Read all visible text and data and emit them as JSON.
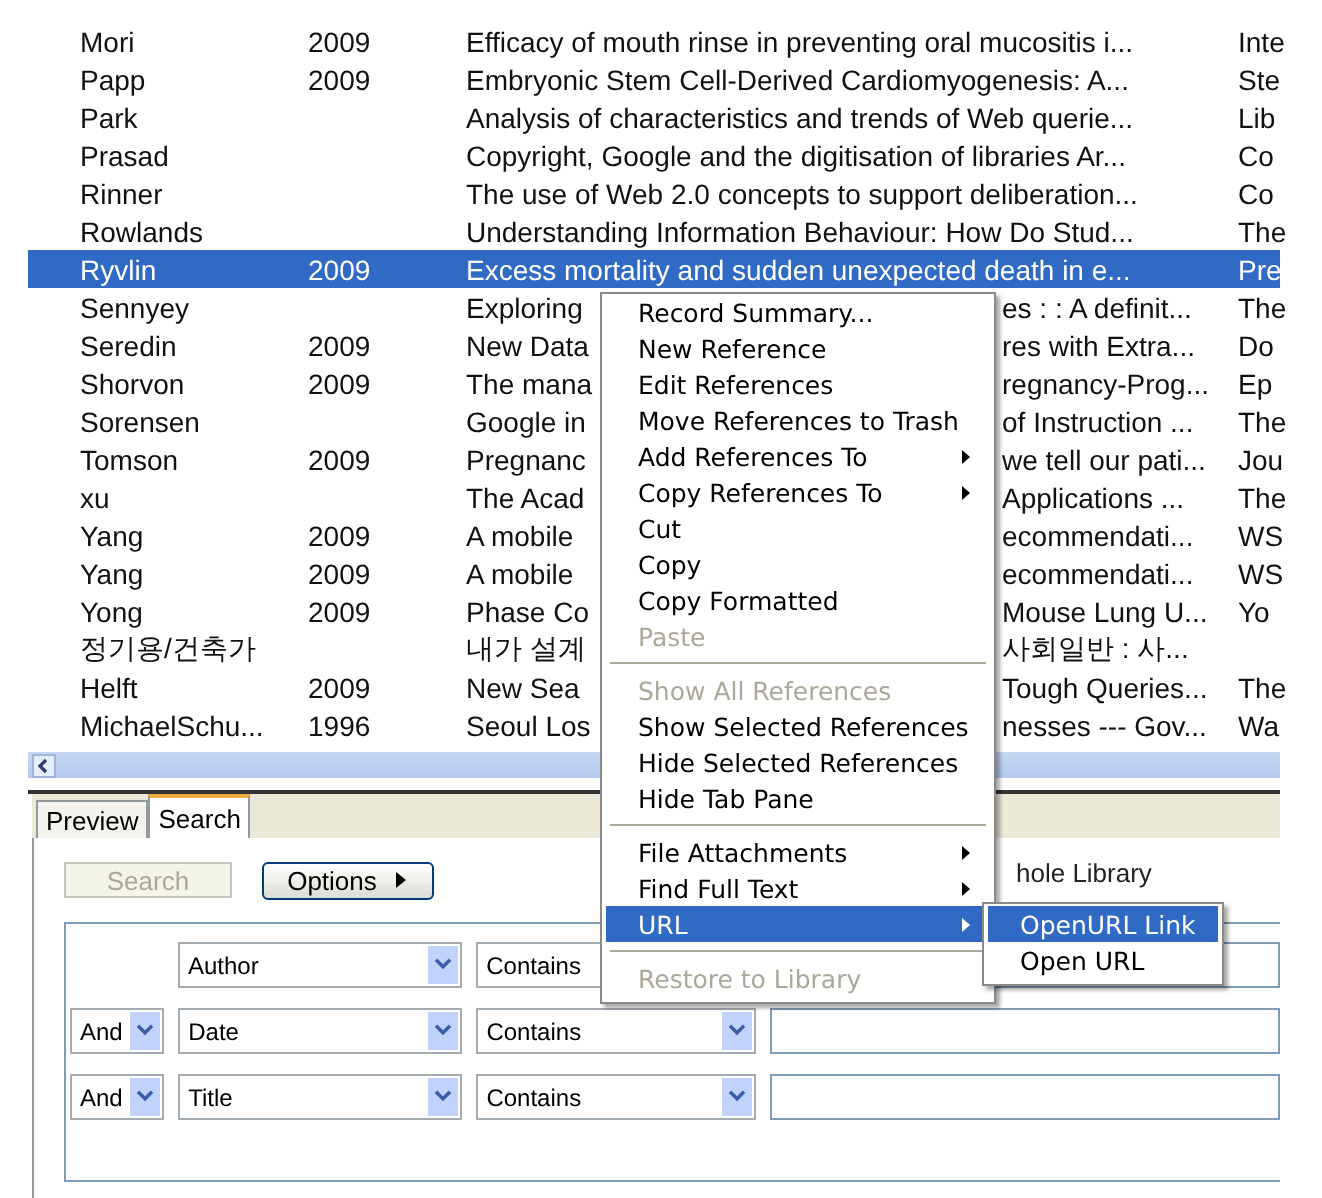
{
  "references": {
    "rows": [
      {
        "author": "Mori",
        "year": "2009",
        "title": "Efficacy of mouth rinse in preventing oral mucositis i...",
        "journal": "Inte",
        "selected": false
      },
      {
        "author": "Papp",
        "year": "2009",
        "title": "Embryonic Stem Cell-Derived Cardiomyogenesis: A...",
        "journal": "Ste",
        "selected": false
      },
      {
        "author": "Park",
        "title": "Analysis of characteristics and trends of Web querie...",
        "journal": "Lib",
        "selected": false
      },
      {
        "author": "Prasad",
        "title": "Copyright, Google and the digitisation of libraries Ar...",
        "journal": "Co",
        "selected": false
      },
      {
        "author": "Rinner",
        "title": "The use of Web 2.0 concepts to support deliberation...",
        "journal": "Co",
        "selected": false
      },
      {
        "author": "Rowlands",
        "title": "Understanding Information Behaviour: How Do Stud...",
        "journal": "The",
        "selected": false
      },
      {
        "author": "Ryvlin",
        "year": "2009",
        "title": "Excess mortality and sudden unexpected death in e...",
        "journal": "Pre",
        "selected": true
      },
      {
        "author": "Sennyey",
        "title_start": "Exploring",
        "title_end": "es : : A definit...",
        "journal": "The",
        "selected": false
      },
      {
        "author": "Seredin",
        "year": "2009",
        "title_start": "New Data",
        "title_end": "res with Extra...",
        "journal": "Do",
        "selected": false
      },
      {
        "author": "Shorvon",
        "year": "2009",
        "title_start": "The mana",
        "title_end": "regnancy-Prog...",
        "journal": "Ep",
        "selected": false
      },
      {
        "author": "Sorensen",
        "title_start": "Google in",
        "title_end": "of Instruction ...",
        "journal": "The",
        "selected": false
      },
      {
        "author": "Tomson",
        "year": "2009",
        "title_start": "Pregnanc",
        "title_end": "we tell our pati...",
        "journal": "Jou",
        "selected": false
      },
      {
        "author": "xu",
        "title_start": "The Acad",
        "title_end": "Applications ...",
        "journal": "The",
        "selected": false
      },
      {
        "author": "Yang",
        "year": "2009",
        "title_start": "A mobile",
        "title_end": "ecommendati...",
        "journal": "WS",
        "selected": false
      },
      {
        "author": "Yang",
        "year": "2009",
        "title_start": "A mobile",
        "title_end": "ecommendati...",
        "journal": "WS",
        "selected": false
      },
      {
        "author": "Yong",
        "year": "2009",
        "title_start": "Phase Co",
        "title_end": "Mouse Lung U...",
        "journal": "Yo",
        "selected": false
      },
      {
        "author": "정기용/건축가",
        "title_start": "내가 설계",
        "title_end": "사회일반 : 사...",
        "selected": false
      },
      {
        "author": "Helft",
        "year": "2009",
        "title_start": "New Sea",
        "title_end": "Tough Queries...",
        "journal": "The",
        "selected": false
      },
      {
        "author": "MichaelSchu...",
        "year": "1996",
        "title_start": "Seoul Los",
        "title_end": "nesses --- Gov...",
        "journal": "Wa",
        "selected": false
      }
    ]
  },
  "tabs": [
    {
      "label": "Preview",
      "selected": false
    },
    {
      "label": "Search",
      "selected": true
    }
  ],
  "search_panel": {
    "search_button": {
      "label": "Search",
      "disabled": true
    },
    "options_button": {
      "label": "Options"
    },
    "scope": "hole Library",
    "criteria": [
      {
        "field": "Author",
        "operator": "Contains"
      },
      {
        "connector": "And",
        "field": "Date",
        "operator": "Contains"
      },
      {
        "connector": "And",
        "field": "Title",
        "operator": "Contains"
      }
    ]
  },
  "context_menu": {
    "items": [
      {
        "kind": "item",
        "label": "Record Summary...",
        "disabled": false,
        "has_submenu": false,
        "selected": false
      },
      {
        "kind": "item",
        "label": "New Reference",
        "disabled": false,
        "has_submenu": false,
        "selected": false
      },
      {
        "kind": "item",
        "label": "Edit References",
        "disabled": false,
        "has_submenu": false,
        "selected": false
      },
      {
        "kind": "item",
        "label": "Move References to Trash",
        "disabled": false,
        "has_submenu": false,
        "selected": false
      },
      {
        "kind": "item",
        "label": "Add References To",
        "disabled": false,
        "has_submenu": true,
        "selected": false
      },
      {
        "kind": "item",
        "label": "Copy References To",
        "disabled": false,
        "has_submenu": true,
        "selected": false
      },
      {
        "kind": "item",
        "label": "Cut",
        "disabled": false,
        "has_submenu": false,
        "selected": false
      },
      {
        "kind": "item",
        "label": "Copy",
        "disabled": false,
        "has_submenu": false,
        "selected": false
      },
      {
        "kind": "item",
        "label": "Copy Formatted",
        "disabled": false,
        "has_submenu": false,
        "selected": false
      },
      {
        "kind": "item",
        "label": "Paste",
        "disabled": true,
        "has_submenu": false,
        "selected": false
      },
      {
        "kind": "separator"
      },
      {
        "kind": "item",
        "label": "Show All References",
        "disabled": true,
        "has_submenu": false,
        "selected": false
      },
      {
        "kind": "item",
        "label": "Show Selected References",
        "disabled": false,
        "has_submenu": false,
        "selected": false
      },
      {
        "kind": "item",
        "label": "Hide Selected References",
        "disabled": false,
        "has_submenu": false,
        "selected": false
      },
      {
        "kind": "item",
        "label": "Hide Tab Pane",
        "disabled": false,
        "has_submenu": false,
        "selected": false
      },
      {
        "kind": "separator"
      },
      {
        "kind": "item",
        "label": "File Attachments",
        "disabled": false,
        "has_submenu": true,
        "selected": false
      },
      {
        "kind": "item",
        "label": "Find Full Text",
        "disabled": false,
        "has_submenu": true,
        "selected": false
      },
      {
        "kind": "item",
        "label": "URL",
        "disabled": false,
        "has_submenu": true,
        "selected": true
      },
      {
        "kind": "separator"
      },
      {
        "kind": "item",
        "label": "Restore to Library",
        "disabled": true,
        "has_submenu": false,
        "selected": false
      }
    ]
  },
  "submenu": {
    "items": [
      {
        "label": "OpenURL Link",
        "selected": true
      },
      {
        "label": "Open URL",
        "selected": false
      }
    ]
  }
}
